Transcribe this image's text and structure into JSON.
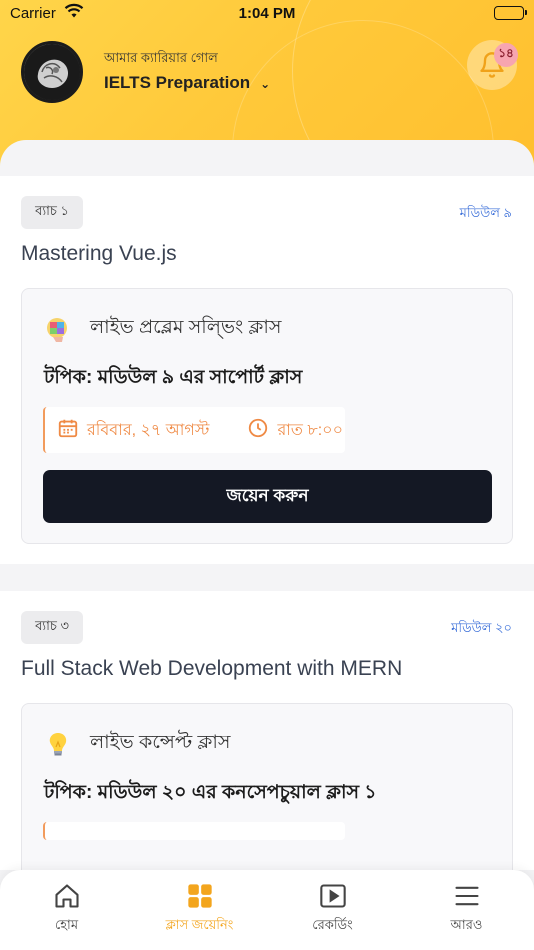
{
  "status_bar": {
    "carrier": "Carrier",
    "time": "1:04 PM"
  },
  "header": {
    "goal_label": "আমার ক্যারিয়ার গোল",
    "goal_value": "IELTS Preparation",
    "notification_count": "১৪"
  },
  "classes": [
    {
      "batch": "ব্যাচ ১",
      "module": "মডিউল ৯",
      "course": "Mastering Vue.js",
      "class_type": "লাইভ প্রব্লেম সল্ভিং ক্লাস",
      "class_icon": "puzzle-head-icon",
      "topic": "টপিক: মডিউল ৯ এর সাপোর্ট ক্লাস",
      "date": "রবিবার, ২৭ আগস্ট",
      "time": "রাত ৮:০০",
      "join_label": "জয়েন করুন"
    },
    {
      "batch": "ব্যাচ ৩",
      "module": "মডিউল ২০",
      "course": "Full Stack Web Development with MERN",
      "class_type": "লাইভ কন্সেপ্ট ক্লাস",
      "class_icon": "lightbulb-icon",
      "topic": "টপিক: মডিউল ২০ এর কনসেপচুয়াল ক্লাস ১"
    }
  ],
  "tabs": [
    {
      "label": "হোম",
      "icon": "home-icon",
      "active": false
    },
    {
      "label": "ক্লাস জয়েনিং",
      "icon": "grid-icon",
      "active": true
    },
    {
      "label": "রেকর্ডিং",
      "icon": "play-icon",
      "active": false
    },
    {
      "label": "আরও",
      "icon": "menu-icon",
      "active": false
    }
  ],
  "colors": {
    "header_yellow": "#ffc93a",
    "accent_orange": "#ef8a45",
    "link_blue": "#3b6fd9",
    "button_dark": "#141824",
    "tab_active": "#f3a51d"
  }
}
